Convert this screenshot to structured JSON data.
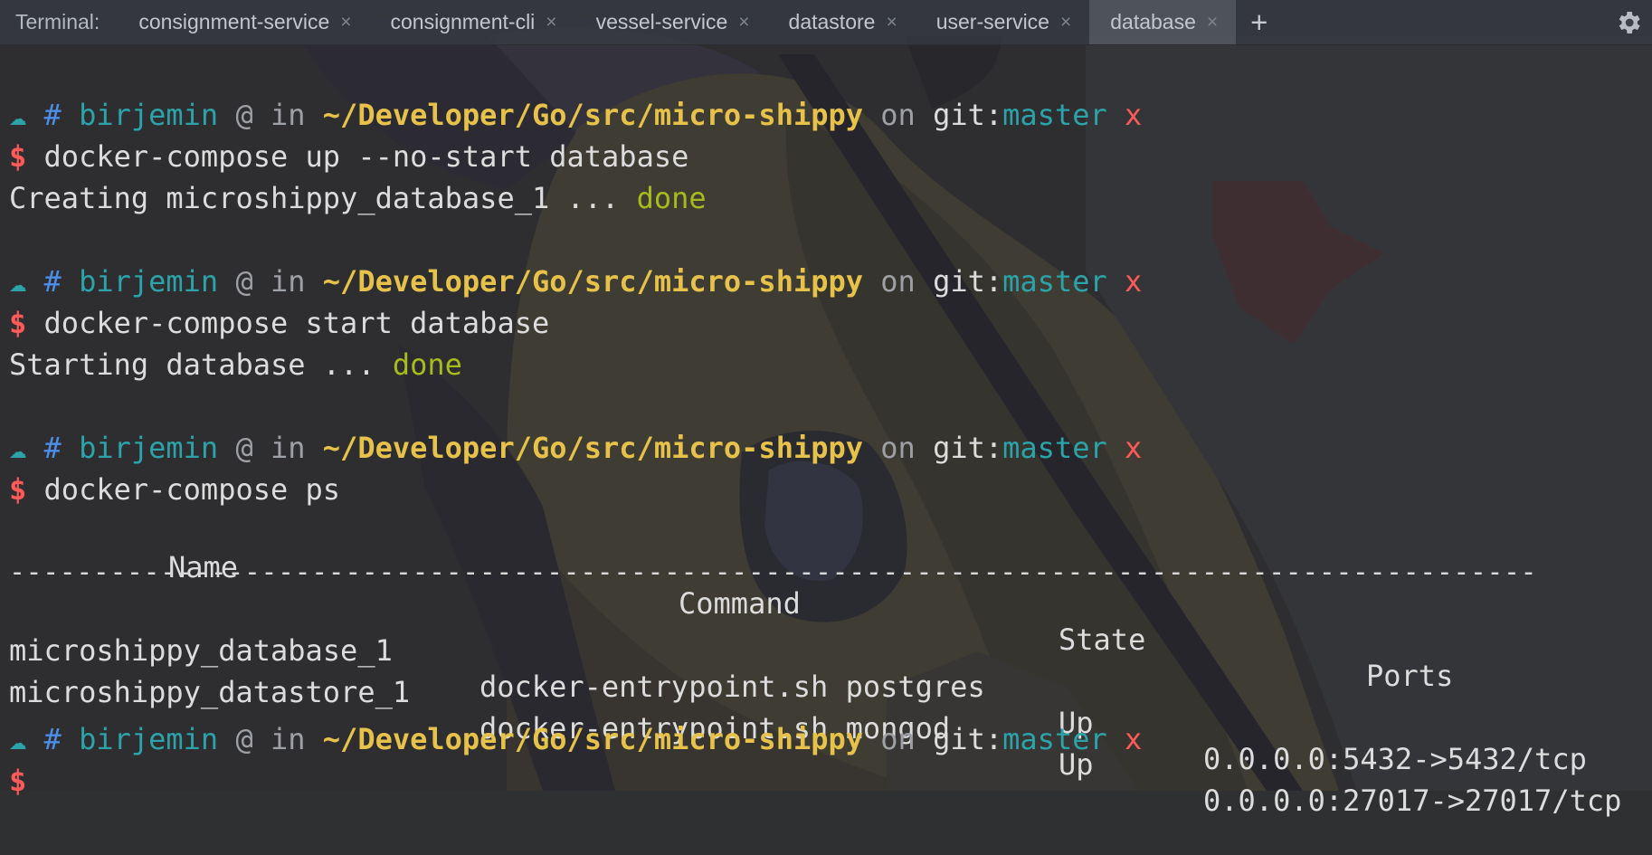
{
  "tabbar": {
    "prefix": "Terminal:",
    "tabs": [
      {
        "label": "consignment-service",
        "active": false
      },
      {
        "label": "consignment-cli",
        "active": false
      },
      {
        "label": "vessel-service",
        "active": false
      },
      {
        "label": "datastore",
        "active": false
      },
      {
        "label": "user-service",
        "active": false
      },
      {
        "label": "database",
        "active": true
      }
    ],
    "close_glyph": "×",
    "add_glyph": "+",
    "settings_icon": "gear-icon"
  },
  "prompt": {
    "cloud": "☁",
    "hash": "#",
    "user": "birjemin",
    "at": "@",
    "in": "in",
    "path": "~/Developer/Go/src/micro-shippy",
    "on": "on",
    "git_label": "git:",
    "branch": "master",
    "dirty": "x",
    "dollar": "$"
  },
  "commands": [
    {
      "command": "docker-compose up --no-start database",
      "output_text": "Creating microshippy_database_1 ... ",
      "output_status": "done"
    },
    {
      "command": "docker-compose start database",
      "output_text": "Starting database ... ",
      "output_status": "done"
    },
    {
      "command": "docker-compose ps"
    }
  ],
  "ps_table": {
    "headers": {
      "name": "Name",
      "command": "Command",
      "state": "State",
      "ports": "Ports"
    },
    "separator": "-------------------------------------------------------------------------------------------",
    "rows": [
      {
        "name": "microshippy_database_1",
        "command": "docker-entrypoint.sh postgres",
        "state": "Up",
        "ports": "0.0.0.0:5432->5432/tcp"
      },
      {
        "name": "microshippy_datastore_1",
        "command": "docker-entrypoint.sh mongod",
        "state": "Up",
        "ports": "0.0.0.0:27017->27017/tcp"
      }
    ]
  },
  "colors": {
    "prompt_cyan": "#2ba3a8",
    "hash_blue": "#4d8ee8",
    "path_yellow": "#e6c24a",
    "done_lime": "#a7bb1c",
    "dirty_red": "#ff5a5a",
    "background": "#2f3032"
  }
}
